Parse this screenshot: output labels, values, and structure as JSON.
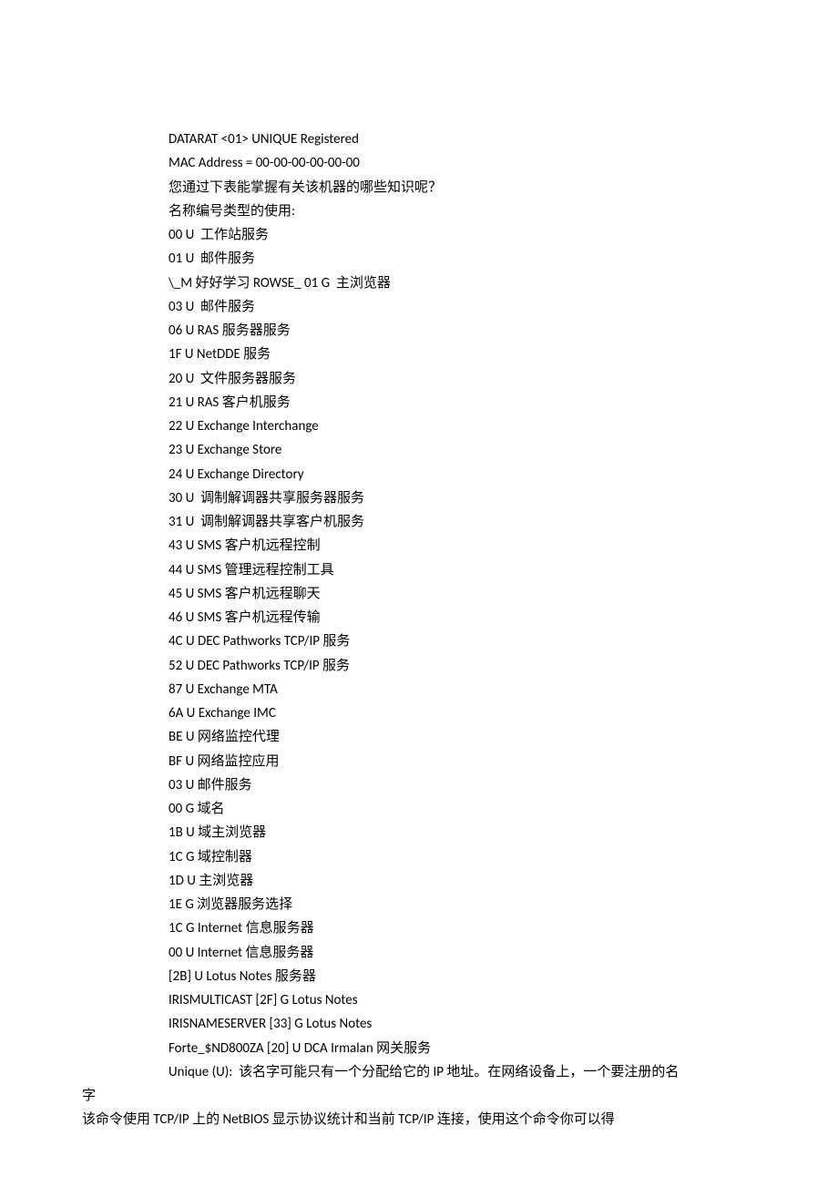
{
  "lines": [
    {
      "text": "DATARAT <01> UNIQUE Registered",
      "indent": true
    },
    {
      "text": "MAC Address = 00-00-00-00-00-00",
      "indent": true
    },
    {
      "text": "您通过下表能掌握有关该机器的哪些知识呢？",
      "indent": true
    },
    {
      "text": "名称编号类型的使用:",
      "indent": true
    },
    {
      "text": "00 U  工作站服务",
      "indent": true
    },
    {
      "text": "01 U  邮件服务",
      "indent": true
    },
    {
      "text": "\\_M 好好学习 ROWSE_ 01 G  主浏览器",
      "indent": true
    },
    {
      "text": "03 U  邮件服务",
      "indent": true
    },
    {
      "text": "06 U RAS 服务器服务",
      "indent": true
    },
    {
      "text": "1F U NetDDE 服务",
      "indent": true
    },
    {
      "text": "20 U  文件服务器服务",
      "indent": true
    },
    {
      "text": "21 U RAS 客户机服务",
      "indent": true
    },
    {
      "text": "22 U Exchange Interchange",
      "indent": true
    },
    {
      "text": "23 U Exchange Store",
      "indent": true
    },
    {
      "text": "24 U Exchange Directory",
      "indent": true
    },
    {
      "text": "30 U  调制解调器共享服务器服务",
      "indent": true
    },
    {
      "text": "31 U  调制解调器共享客户机服务",
      "indent": true
    },
    {
      "text": "43 U SMS 客户机远程控制",
      "indent": true
    },
    {
      "text": "44 U SMS 管理远程控制工具",
      "indent": true
    },
    {
      "text": "45 U SMS 客户机远程聊天",
      "indent": true
    },
    {
      "text": "46 U SMS 客户机远程传输",
      "indent": true
    },
    {
      "text": "4C U DEC Pathworks TCP/IP 服务",
      "indent": true
    },
    {
      "text": "52 U DEC Pathworks TCP/IP 服务",
      "indent": true
    },
    {
      "text": "87 U Exchange MTA",
      "indent": true
    },
    {
      "text": "6A U Exchange IMC",
      "indent": true
    },
    {
      "text": "BE U 网络监控代理",
      "indent": true
    },
    {
      "text": "BF U 网络监控应用",
      "indent": true
    },
    {
      "text": "03 U 邮件服务",
      "indent": true
    },
    {
      "text": "00 G 域名",
      "indent": true
    },
    {
      "text": "1B U 域主浏览器",
      "indent": true
    },
    {
      "text": "1C G 域控制器",
      "indent": true
    },
    {
      "text": "1D U 主浏览器",
      "indent": true
    },
    {
      "text": "1E G 浏览器服务选择",
      "indent": true
    },
    {
      "text": "1C G Internet 信息服务器",
      "indent": true
    },
    {
      "text": "00 U Internet 信息服务器",
      "indent": true
    },
    {
      "text": "[2B] U Lotus Notes 服务器",
      "indent": true
    },
    {
      "text": "IRISMULTICAST [2F] G Lotus Notes",
      "indent": true
    },
    {
      "text": "IRISNAMESERVER [33] G Lotus Notes",
      "indent": true
    },
    {
      "text": "Forte_$ND800ZA [20] U DCA Irmalan 网关服务",
      "indent": true
    },
    {
      "text": "Unique (U):  该名字可能只有一个分配给它的 IP 地址。在网络设备上，一个要注册的名",
      "indent": true
    },
    {
      "text": "字",
      "indent": false
    },
    {
      "text": "该命令使用 TCP/IP 上的 NetBIOS 显示协议统计和当前 TCP/IP 连接，使用这个命令你可以得",
      "indent": false
    }
  ]
}
